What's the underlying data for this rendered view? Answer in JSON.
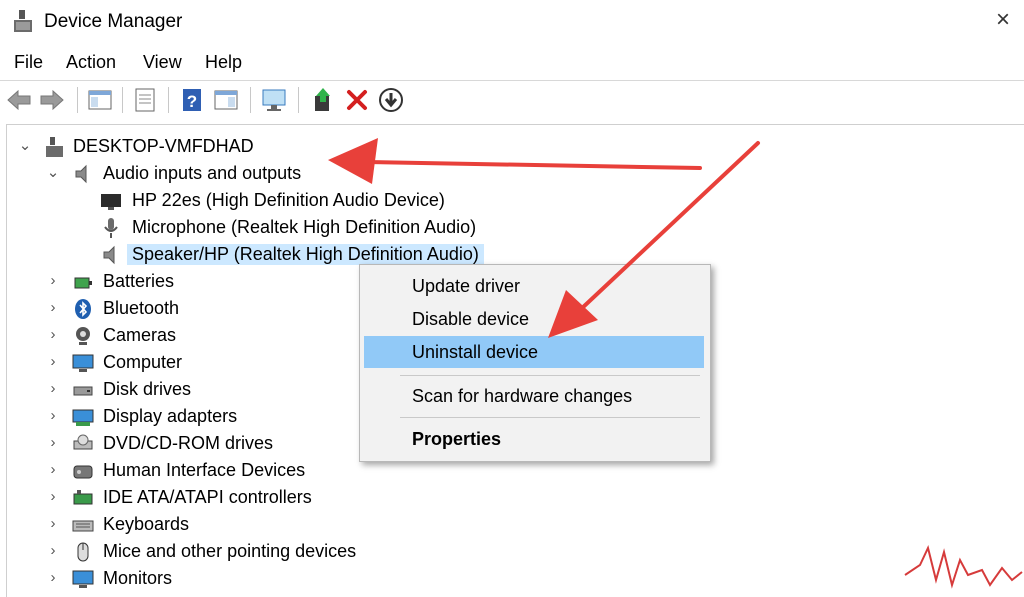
{
  "window": {
    "title": "Device Manager",
    "close_glyph": "×"
  },
  "menu": [
    "File",
    "Action",
    "View",
    "Help"
  ],
  "toolbar": {
    "buttons": [
      "back-arrow-icon",
      "forward-arrow-icon",
      "show-hide-console-tree-icon",
      "properties-icon",
      "help-icon",
      "action-pane-icon",
      "scan-hardware-icon",
      "update-driver-icon",
      "uninstall-icon",
      "disable-device-icon"
    ]
  },
  "tree": {
    "root": "DESKTOP-VMFDHAD",
    "expanded_category": "Audio inputs and outputs",
    "audio_devices": [
      "HP 22es (High Definition Audio Device)",
      "Microphone (Realtek High Definition Audio)",
      "Speaker/HP (Realtek High Definition Audio)"
    ],
    "selected_device": "Speaker/HP (Realtek High Definition Audio)",
    "categories": [
      "Batteries",
      "Bluetooth",
      "Cameras",
      "Computer",
      "Disk drives",
      "Display adapters",
      "DVD/CD-ROM drives",
      "Human Interface Devices",
      "IDE ATA/ATAPI controllers",
      "Keyboards",
      "Mice and other pointing devices",
      "Monitors"
    ]
  },
  "context_menu": {
    "items": [
      "Update driver",
      "Disable device",
      "Uninstall device",
      "Scan for hardware changes",
      "Properties"
    ],
    "highlighted": "Uninstall device",
    "bold": "Properties"
  },
  "colors": {
    "selection": "#cce8ff",
    "menu_highlight": "#91c9f7",
    "annotation_arrow": "#e8403a",
    "watermark": "#d63b3b"
  }
}
